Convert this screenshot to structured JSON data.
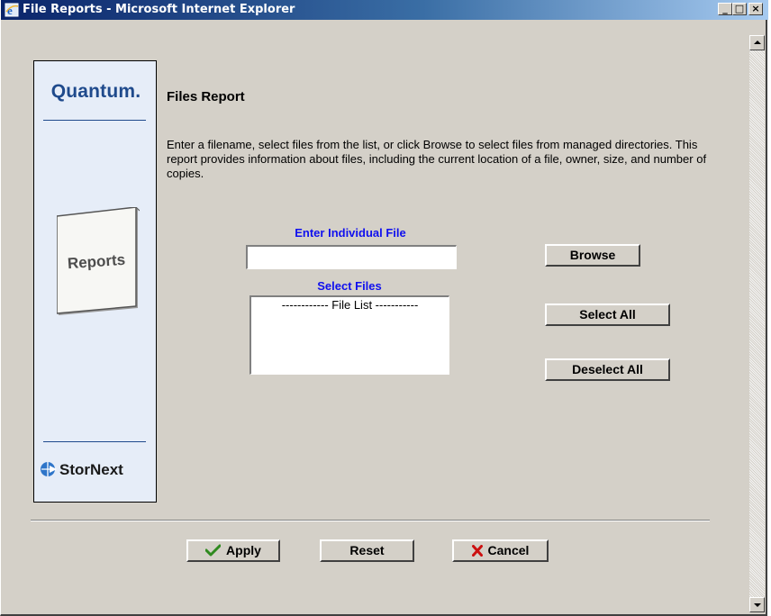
{
  "window": {
    "title": "File Reports - Microsoft Internet Explorer",
    "minimize_label": "_",
    "maximize_label": "□",
    "close_label": "×"
  },
  "sidebar": {
    "brand_logo": "Quantum.",
    "section_label": "Reports",
    "product_logo": "StorNext",
    "brand_color": "#1f4a8c"
  },
  "main": {
    "title": "Files Report",
    "description": "Enter a filename, select files from the list, or click Browse to select files from managed directories. This report provides information about files, including the current location of a file, owner, size, and number of copies.",
    "individual_file": {
      "label": "Enter Individual File",
      "value": ""
    },
    "select_files": {
      "label": "Select Files",
      "options": [
        "------------ File List -----------"
      ]
    },
    "label_color": "#1010ee"
  },
  "buttons": {
    "browse": "Browse",
    "select_all": "Select All",
    "deselect_all": "Deselect All"
  },
  "actions": {
    "apply": "Apply",
    "reset": "Reset",
    "cancel": "Cancel",
    "apply_icon": "checkmark-icon",
    "cancel_icon": "x-icon"
  }
}
